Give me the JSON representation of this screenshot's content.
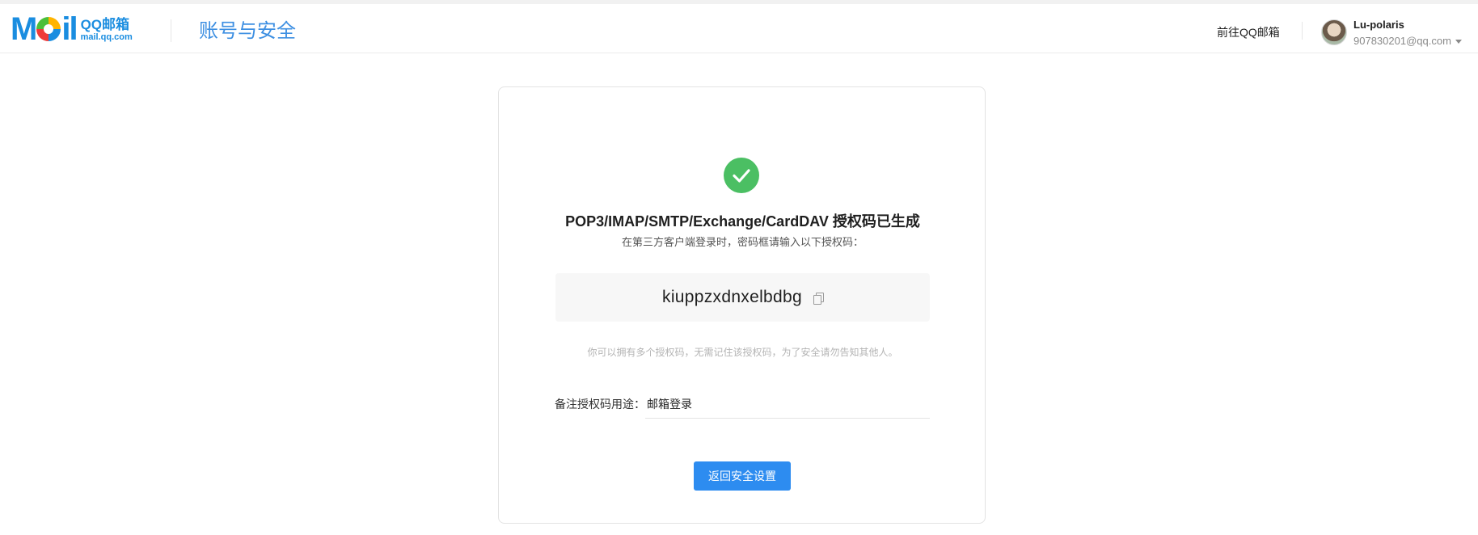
{
  "header": {
    "logo_mark_letters": [
      "M",
      "i",
      "l"
    ],
    "logo_text_top": "QQ邮箱",
    "logo_text_bottom": "mail.qq.com",
    "title": "账号与安全",
    "goto_mail_link": "前往QQ邮箱",
    "user": {
      "name": "Lu-polaris",
      "email": "907830201@qq.com"
    }
  },
  "card": {
    "title": "POP3/IMAP/SMTP/Exchange/CardDAV 授权码已生成",
    "subtitle": "在第三方客户端登录时，密码框请输入以下授权码：",
    "auth_code": "kiuppzxdnxelbdbg",
    "note": "你可以拥有多个授权码，无需记住该授权码，为了安全请勿告知其他人。",
    "remark_label": "备注授权码用途：",
    "remark_value": "邮箱登录",
    "back_button": "返回安全设置"
  },
  "colors": {
    "brand_blue": "#1a8de0",
    "title_blue": "#3d8fe2",
    "success_green": "#4bbf63",
    "button_blue": "#2d8cf0"
  },
  "icons": {
    "success": "check-circle-icon",
    "copy": "copy-icon",
    "dropdown": "caret-down-icon"
  }
}
